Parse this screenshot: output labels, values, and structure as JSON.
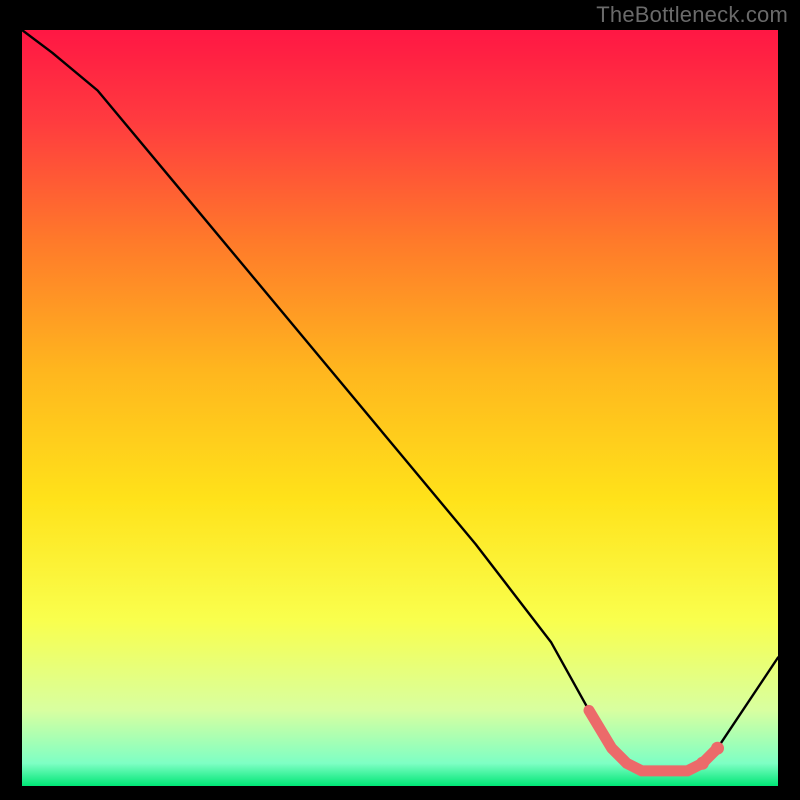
{
  "watermark": "TheBottleneck.com",
  "colors": {
    "gradient": [
      {
        "offset": "0%",
        "hex": "#ff1744"
      },
      {
        "offset": "12%",
        "hex": "#ff3b3f"
      },
      {
        "offset": "28%",
        "hex": "#ff7a2a"
      },
      {
        "offset": "45%",
        "hex": "#ffb61e"
      },
      {
        "offset": "62%",
        "hex": "#ffe21a"
      },
      {
        "offset": "78%",
        "hex": "#f9ff4d"
      },
      {
        "offset": "90%",
        "hex": "#d8ffa0"
      },
      {
        "offset": "97%",
        "hex": "#7effc4"
      },
      {
        "offset": "100%",
        "hex": "#00e676"
      }
    ],
    "curve": "#000000",
    "marker": "#ec6a6a",
    "background": "#000000"
  },
  "chart_data": {
    "type": "line",
    "title": "",
    "xlabel": "",
    "ylabel": "",
    "xlim": [
      0,
      100
    ],
    "ylim": [
      0,
      100
    ],
    "grid": false,
    "legend": false,
    "x": [
      0,
      4,
      10,
      20,
      30,
      40,
      50,
      60,
      70,
      75,
      78,
      80,
      82,
      84,
      86,
      88,
      90,
      92,
      100
    ],
    "values": [
      100,
      97,
      92,
      80,
      68,
      56,
      44,
      32,
      19,
      10,
      5,
      3,
      2,
      2,
      2,
      2,
      3,
      5,
      17
    ],
    "marker_segment": {
      "x": [
        75,
        78,
        80,
        82,
        84,
        86,
        88,
        90,
        92
      ],
      "y": [
        10,
        5,
        3,
        2,
        2,
        2,
        2,
        3,
        5
      ]
    },
    "marker_dots": {
      "x": [
        90,
        92
      ],
      "y": [
        3,
        5
      ]
    }
  }
}
